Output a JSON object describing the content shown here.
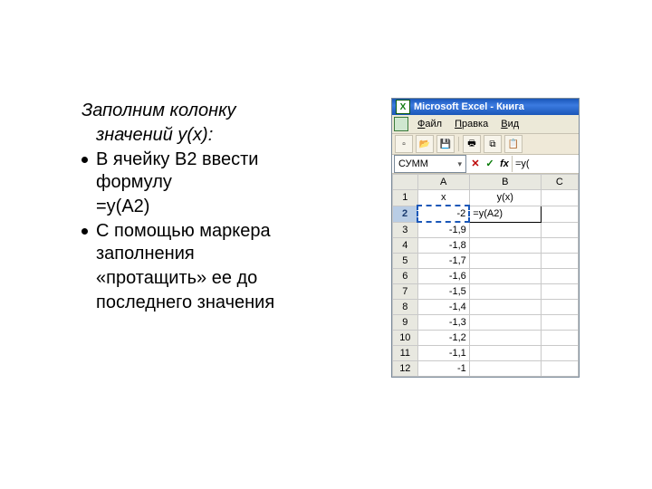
{
  "text": {
    "lead1": "Заполним колонку",
    "lead2": "значений y(x):",
    "b1_l1": "В ячейку В2 ввести",
    "b1_l2": "формулу",
    "b1_l3": "=y(A2)",
    "b2_l1": "С помощью маркера",
    "b2_l2": "заполнения",
    "b2_l3": "«протащить» ее до",
    "b2_l4": "последнего значения"
  },
  "excel": {
    "title": "Microsoft Excel - Книга",
    "menu": {
      "file": "айл",
      "file_u": "Ф",
      "edit": "равка",
      "edit_u": "П",
      "view": "ид",
      "view_u": "В"
    },
    "toolbar_icons": [
      "new",
      "open",
      "save",
      "print",
      "copy",
      "paste"
    ],
    "name_box": "СУММ",
    "fx_label": "fx",
    "formula": "=y(",
    "cancel": "✕",
    "ok": "✓",
    "col_headers": [
      "A",
      "B",
      "C"
    ],
    "header_row": {
      "A": "x",
      "B": "y(x)"
    },
    "active_cell_text": "=y(A2)",
    "rows": [
      {
        "n": 1,
        "A": "",
        "B": ""
      },
      {
        "n": 2,
        "A": "-2",
        "B": ""
      },
      {
        "n": 3,
        "A": "-1,9",
        "B": ""
      },
      {
        "n": 4,
        "A": "-1,8",
        "B": ""
      },
      {
        "n": 5,
        "A": "-1,7",
        "B": ""
      },
      {
        "n": 6,
        "A": "-1,6",
        "B": ""
      },
      {
        "n": 7,
        "A": "-1,5",
        "B": ""
      },
      {
        "n": 8,
        "A": "-1,4",
        "B": ""
      },
      {
        "n": 9,
        "A": "-1,3",
        "B": ""
      },
      {
        "n": 10,
        "A": "-1,2",
        "B": ""
      },
      {
        "n": 11,
        "A": "-1,1",
        "B": ""
      },
      {
        "n": 12,
        "A": "-1",
        "B": ""
      }
    ]
  }
}
